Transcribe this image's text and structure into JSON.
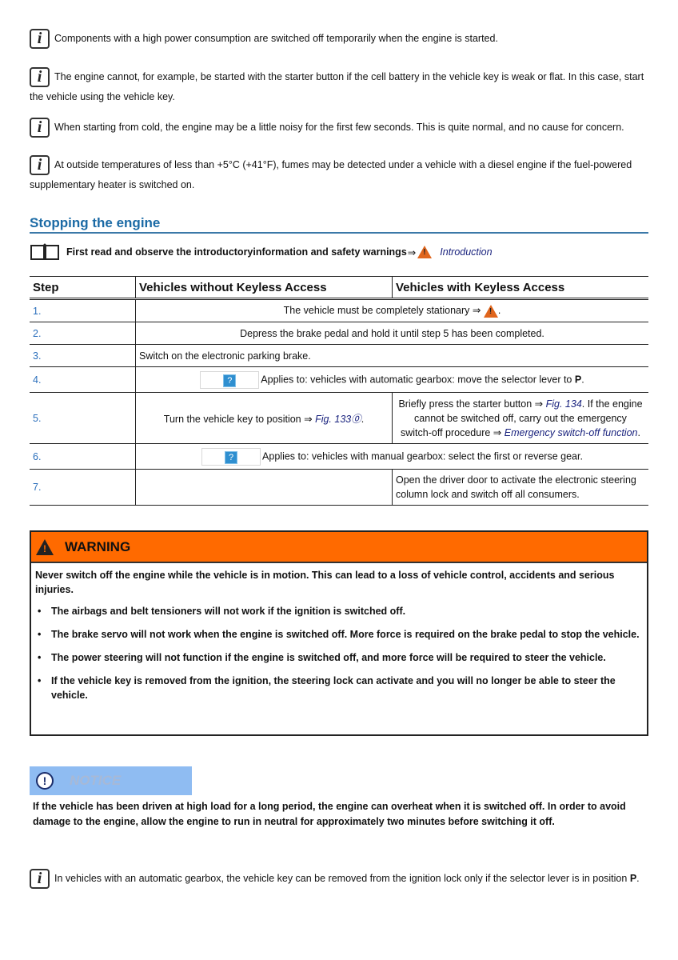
{
  "notes_top": [
    {
      "icon": "info-icon",
      "text": "Components with a high power consumption are switched off temporarily when the engine is started."
    },
    {
      "icon": "info-icon",
      "text": "The engine cannot, for example, be started with the starter button if the cell battery in the vehicle key is weak or flat. In this case, start the vehicle using the vehicle key."
    },
    {
      "icon": "info-icon",
      "text": "When starting from cold, the engine may be a little noisy for the first few seconds. This is quite normal, and no cause for concern."
    },
    {
      "icon": "info-icon",
      "text": "At outside temperatures of less than +5°C (+41°F), fumes may be detected under a vehicle with a diesel engine if the fuel-powered supplementary heater is switched on."
    }
  ],
  "section": {
    "title": "Stopping the engine",
    "intro_text": "First read and observe the introductoryinformation and safety warnings",
    "intro_arrow": "⇒",
    "intro_link": "Introduction"
  },
  "table": {
    "headers": [
      "Step",
      "Vehicles without Keyless Access",
      "Vehicles with Keyless Access"
    ],
    "rows": [
      {
        "step": "1.",
        "text": "The vehicle must be completely stationary ⇒",
        "suffix": "."
      },
      {
        "step": "2.",
        "text": "Depress the brake pedal and hold it until step 5 has been completed."
      },
      {
        "step": "3.",
        "text": "Switch on the electronic parking brake."
      },
      {
        "step": "4.",
        "qmark": "?",
        "text": "Applies to: vehicles with automatic gearbox: move the selector lever to ",
        "bold": "P",
        "suffix": "."
      },
      {
        "step": "5.",
        "without_text": "Turn the vehicle key to position ⇒ ",
        "without_link": "Fig. 133⓪",
        "without_suffix": ".",
        "with_text1": "Briefly press the starter button ⇒ ",
        "with_link1": "Fig. 134",
        "with_text2": ". If the engine cannot be switched off, carry out the emergency switch-off procedure ⇒ ",
        "with_link2": "Emergency switch-off function",
        "with_suffix": "."
      },
      {
        "step": "6.",
        "qmark": "?",
        "text": "Applies to: vehicles with manual gearbox: select the first or reverse gear."
      },
      {
        "step": "7.",
        "without_text": "",
        "with_text": "Open the driver door to activate the electronic steering column lock and switch off all consumers."
      }
    ]
  },
  "warning": {
    "label": "WARNING",
    "intro": "Never switch off the engine while the vehicle is in motion. This can lead to a loss of vehicle control, accidents and serious injuries.",
    "bullets": [
      "The airbags and belt tensioners will not work if the ignition is switched off.",
      "The brake servo will not work when the engine is switched off. More force is required on the brake pedal to stop the vehicle.",
      "The power steering will not function if the engine is switched off, and more force will be required to steer the vehicle.",
      "If the vehicle key is removed from the ignition, the steering lock can activate and you will no longer be able to steer the vehicle."
    ],
    "color": "#ff6a00"
  },
  "notice": {
    "label": "NOTICE",
    "icon_glyph": "!",
    "text": "If the vehicle has been driven at high load for a long period, the engine can overheat when it is switched off. In order to avoid damage to the engine, allow the engine to run in neutral for approximately two minutes before switching it off.",
    "color": "#8fbcf2"
  },
  "note_bottom": {
    "icon": "info-icon",
    "text": "In vehicles with an automatic gearbox, the vehicle key can be removed from the ignition lock only if the selector lever is in position ",
    "bold": "P",
    "suffix": "."
  }
}
